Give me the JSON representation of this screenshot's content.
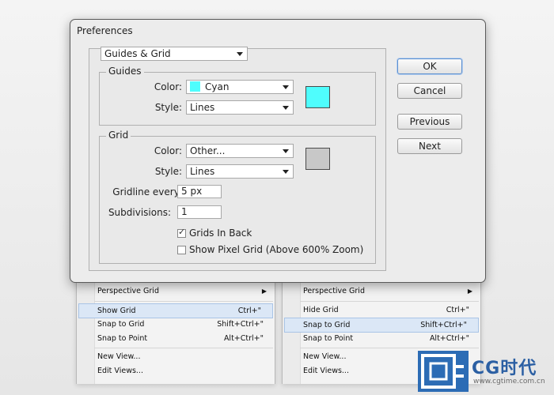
{
  "left_menu": {
    "items": [
      {
        "label": "Perspective Grid",
        "shortcut": "",
        "submenu": true,
        "highlight": false
      },
      {
        "label": "Show Grid",
        "shortcut": "Ctrl+\"",
        "submenu": false,
        "highlight": true
      },
      {
        "label": "Snap to Grid",
        "shortcut": "Shift+Ctrl+\"",
        "submenu": false,
        "highlight": false
      },
      {
        "label": "Snap to Point",
        "shortcut": "Alt+Ctrl+\"",
        "submenu": false,
        "highlight": false
      },
      {
        "label": "New View...",
        "shortcut": "",
        "submenu": false,
        "highlight": false
      },
      {
        "label": "Edit Views...",
        "shortcut": "",
        "submenu": false,
        "highlight": false
      }
    ]
  },
  "right_menu": {
    "items": [
      {
        "label": "Perspective Grid",
        "shortcut": "",
        "submenu": true,
        "highlight": false
      },
      {
        "label": "Hide Grid",
        "shortcut": "Ctrl+\"",
        "submenu": false,
        "highlight": false
      },
      {
        "label": "Snap to Grid",
        "shortcut": "Shift+Ctrl+\"",
        "submenu": false,
        "highlight": true
      },
      {
        "label": "Snap to Point",
        "shortcut": "Alt+Ctrl+\"",
        "submenu": false,
        "highlight": false
      },
      {
        "label": "New View...",
        "shortcut": "",
        "submenu": false,
        "highlight": false
      },
      {
        "label": "Edit Views...",
        "shortcut": "",
        "submenu": false,
        "highlight": false
      }
    ]
  },
  "dialog": {
    "title": "Preferences",
    "section_select": "Guides & Grid",
    "guides": {
      "group_label": "Guides",
      "color_label": "Color:",
      "color_value": "Cyan",
      "color_hex": "#4ffdfd",
      "style_label": "Style:",
      "style_value": "Lines"
    },
    "grid": {
      "group_label": "Grid",
      "color_label": "Color:",
      "color_value": "Other...",
      "color_hex": "#c8c8c8",
      "style_label": "Style:",
      "style_value": "Lines",
      "gridline_label": "Gridline every:",
      "gridline_value": "5 px",
      "subdivisions_label": "Subdivisions:",
      "subdivisions_value": "1",
      "grids_in_back_label": "Grids In Back",
      "grids_in_back_checked": true,
      "pixel_grid_label": "Show Pixel Grid (Above 600% Zoom)",
      "pixel_grid_checked": false
    },
    "buttons": {
      "ok": "OK",
      "cancel": "Cancel",
      "previous": "Previous",
      "next": "Next"
    }
  },
  "watermark": {
    "brand": "CG时代",
    "url": "www.cgtime.com.cn"
  }
}
